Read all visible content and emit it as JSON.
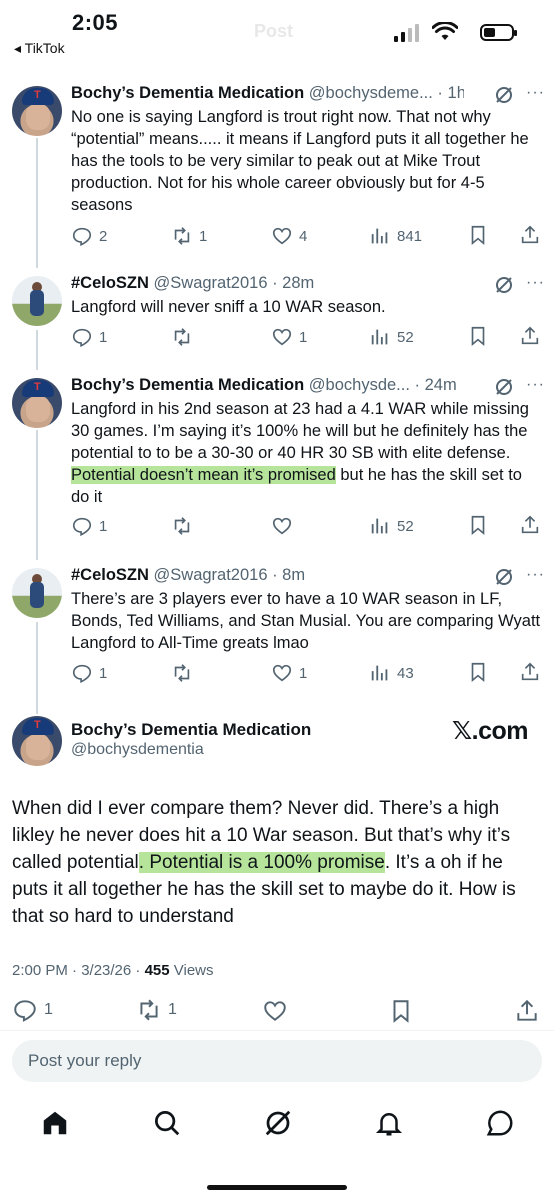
{
  "status_bar": {
    "time": "2:05",
    "back_app": "◂ TikTok",
    "ghost_title": "Post"
  },
  "tweets": [
    {
      "name": "Bochy’s Dementia Medication",
      "meta": "@bochysdeme... · 1h",
      "text": "No one is saying Langford is trout right now. That not why “potential” means..... it means if Langford puts it all together he has the tools to be very similar to peak out at Mike Trout production. Not for his whole career obviously but for 4-5 seasons",
      "replies": "2",
      "reposts": "1",
      "likes": "4",
      "views": "841",
      "avatar": "rangers-cap-avatar"
    },
    {
      "name": "#CeloSZN",
      "meta": "@Swagrat2016 · 28m",
      "text": "Langford will never sniff a 10 WAR season.",
      "replies": "1",
      "reposts": "",
      "likes": "1",
      "views": "52",
      "avatar": "baseball-player-avatar"
    },
    {
      "name": "Bochy’s Dementia Medication",
      "meta": "@bochysde... · 24m",
      "text_before": "Langford in his 2nd season at 23 had a 4.1 WAR while missing 30 games. I’m saying it’s 100% he will but he definitely has the potential to to be a 30-30 or 40 HR 30 SB with elite defense.",
      "text_highlight": " Potential doesn’t mean it’s promised",
      "text_after": " but he has the skill set to do it",
      "replies": "1",
      "reposts": "",
      "likes": "",
      "views": "52",
      "avatar": "rangers-cap-avatar"
    },
    {
      "name": "#CeloSZN",
      "meta": "@Swagrat2016 · 8m",
      "text": "There’s are 3 players ever to have a 10 WAR season in LF, Bonds, Ted Williams, and Stan Musial. You are comparing Wyatt Langford to All-Time greats lmao",
      "replies": "1",
      "reposts": "",
      "likes": "1",
      "views": "43",
      "avatar": "baseball-player-avatar"
    }
  ],
  "main_tweet": {
    "name": "Bochy’s Dementia Medication",
    "handle": "@bochysdementia",
    "watermark": "𝕏.com",
    "text_before": "When did I ever compare them? Never did. There’s a high likley he never does hit a 10 War season. But that’s why it’s called potential",
    "text_highlight": ". Potential is a 100% promise",
    "text_after": ". It’s a oh if he puts it all together he has the skill set to maybe do it. How is that so hard to understand",
    "timestamp": "2:00 PM · 3/23/26 · ",
    "views_count": "455",
    "views_label": " Views",
    "replies": "1",
    "reposts": "1"
  },
  "reply_box": {
    "placeholder": "Post your reply"
  },
  "tab_bar": [
    "home-icon",
    "search-icon",
    "grok-icon",
    "notifications-icon",
    "messages-icon"
  ]
}
